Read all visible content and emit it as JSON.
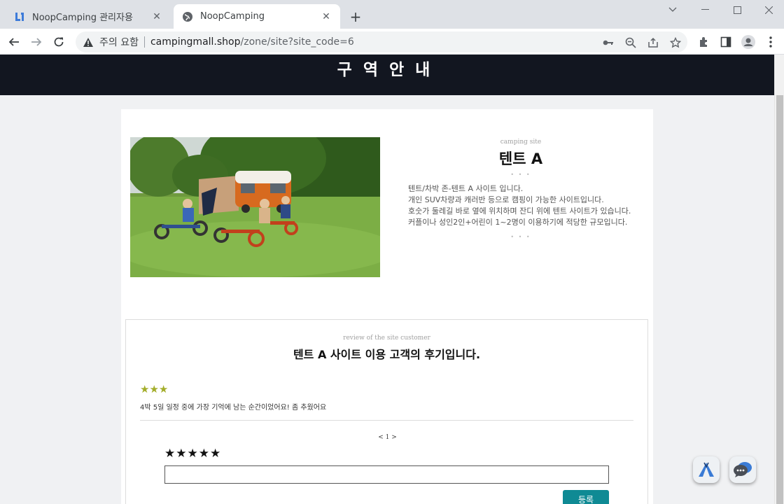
{
  "browser": {
    "tabs": [
      {
        "title": "NoopCamping 관리자용",
        "favicon": "noop-logo-icon",
        "active": false
      },
      {
        "title": "NoopCamping",
        "favicon": "globe-icon",
        "active": true
      }
    ],
    "omnibox": {
      "security_label": "주의 요함",
      "url_host": "campingmall.shop",
      "url_path": "/zone/site?site_code=6"
    }
  },
  "page": {
    "hero_title": "구 역 안 내",
    "site": {
      "subtitle": "camping site",
      "name": "텐트 A",
      "dots": "• • •",
      "description": [
        "텐트/차박 존-텐트 A 사이트 입니다.",
        "개인 SUV차량과 캐러반 등으로 캠핑이 가능한 사이트입니다.",
        "호숫가 둘레길 바로 옆에 위치하며 잔디 위에 텐트 사이트가 있습니다.",
        "커플이나 성인2인+어린이 1~2명이 이용하기에 적당한 규모입니다."
      ],
      "dots_bottom": "• • •"
    },
    "reviews": {
      "subtitle": "review of the site customer",
      "heading": "텐트 A 사이트 이용 고객의 후기입니다.",
      "items": [
        {
          "rating": 3,
          "stars": "★★★",
          "text": "4박 5일 일정 중에 가장 기억에 남는 순간이었어요! 좀 추웠어요"
        }
      ],
      "pager": "< 1 >",
      "rating_input": "★★★★★",
      "input_value": "",
      "submit_label": "등록"
    }
  },
  "colors": {
    "hero_bg": "#121620",
    "star_gold": "#a3ad2a",
    "submit_bg": "#0f8a94"
  }
}
